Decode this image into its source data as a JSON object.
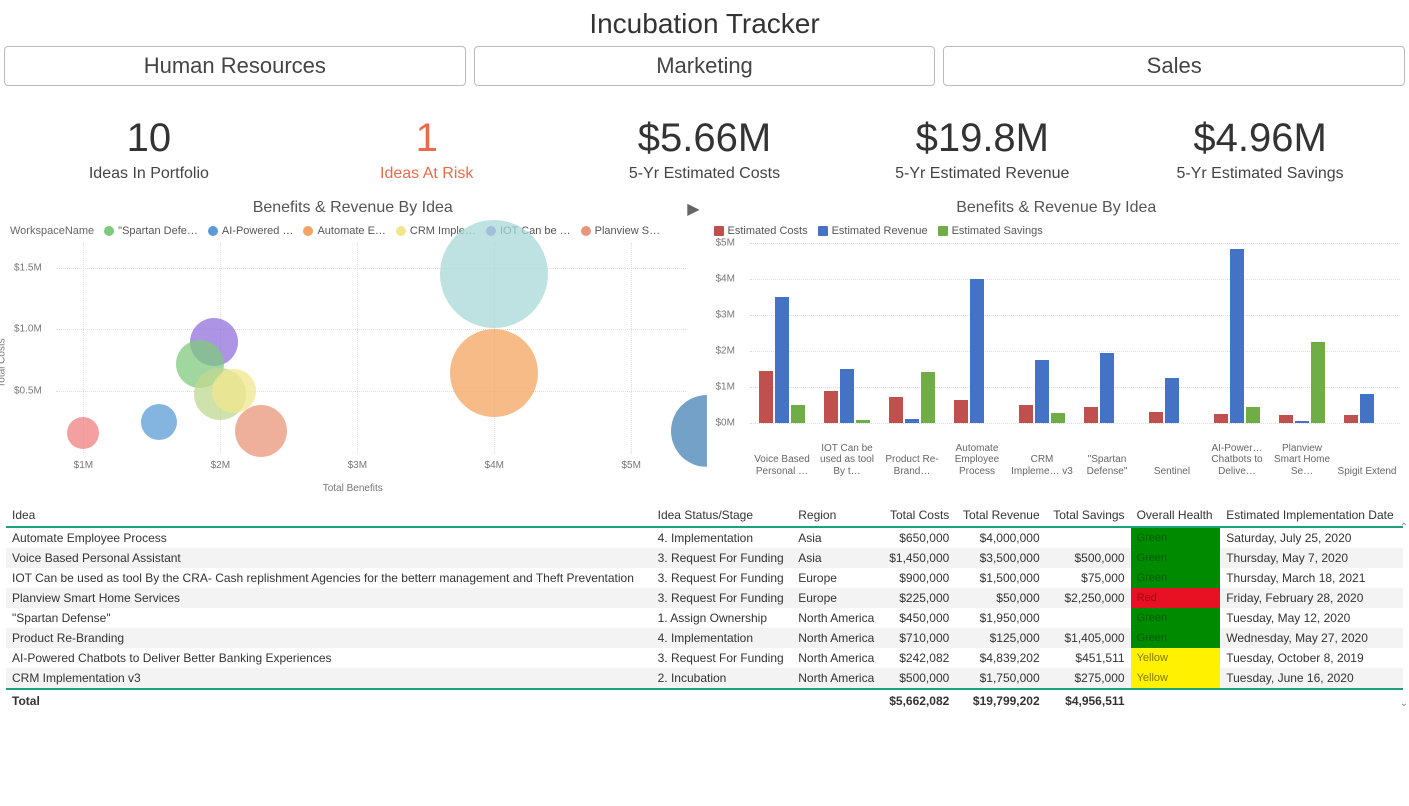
{
  "page": {
    "title": "Incubation Tracker"
  },
  "tabs": [
    "Human Resources",
    "Marketing",
    "Sales"
  ],
  "kpis": [
    {
      "value": "10",
      "label": "Ideas In Portfolio",
      "risk": false
    },
    {
      "value": "1",
      "label": "Ideas At Risk",
      "risk": true
    },
    {
      "value": "$5.66M",
      "label": "5-Yr Estimated Costs",
      "risk": false
    },
    {
      "value": "$19.8M",
      "label": "5-Yr Estimated Revenue",
      "risk": false
    },
    {
      "value": "$4.96M",
      "label": "5-Yr Estimated Savings",
      "risk": false
    }
  ],
  "colors": {
    "series": {
      "costs": "#c0504d",
      "revenue": "#4472c4",
      "savings": "#70ad47"
    },
    "bubble": {
      "spartan": "#7fc97f",
      "ai": "#5b9bd5",
      "automate": "#f4a460",
      "crm": "#f0e68c",
      "iot": "#9370db",
      "planview": "#e9967a",
      "voice": "#a8d8d8",
      "product": "#c0d890",
      "sentinel": "#f08080",
      "spigit": "#4682b4"
    }
  },
  "chart_data": [
    {
      "id": "bubbles",
      "type": "scatter",
      "title": "Benefits & Revenue By Idea",
      "xlabel": "Total Benefits",
      "ylabel": "Total Costs",
      "legend_prefix": "WorkspaceName",
      "legend": [
        {
          "label": "\"Spartan Defe…",
          "colorKey": "spartan"
        },
        {
          "label": "AI-Powered …",
          "colorKey": "ai"
        },
        {
          "label": "Automate E…",
          "colorKey": "automate"
        },
        {
          "label": "CRM Imple…",
          "colorKey": "crm"
        },
        {
          "label": "IOT Can be …",
          "colorKey": "iot"
        },
        {
          "label": "Planview S…",
          "colorKey": "planview"
        }
      ],
      "xlim": [
        800000,
        5400000
      ],
      "ylim": [
        0,
        1700000
      ],
      "xticks": [
        {
          "v": 1000000,
          "t": "$1M"
        },
        {
          "v": 2000000,
          "t": "$2M"
        },
        {
          "v": 3000000,
          "t": "$3M"
        },
        {
          "v": 4000000,
          "t": "$4M"
        },
        {
          "v": 5000000,
          "t": "$5M"
        }
      ],
      "yticks": [
        {
          "v": 500000,
          "t": "$0.5M"
        },
        {
          "v": 1000000,
          "t": "$1.0M"
        },
        {
          "v": 1500000,
          "t": "$1.5M"
        }
      ],
      "points": [
        {
          "x": 4000000,
          "y": 1450000,
          "r": 54,
          "colorKey": "voice"
        },
        {
          "x": 4000000,
          "y": 650000,
          "r": 44,
          "colorKey": "automate"
        },
        {
          "x": 1950000,
          "y": 900000,
          "r": 24,
          "colorKey": "iot"
        },
        {
          "x": 1850000,
          "y": 720000,
          "r": 24,
          "colorKey": "spartan"
        },
        {
          "x": 2000000,
          "y": 480000,
          "r": 26,
          "colorKey": "product"
        },
        {
          "x": 2100000,
          "y": 500000,
          "r": 22,
          "colorKey": "crm"
        },
        {
          "x": 1550000,
          "y": 250000,
          "r": 18,
          "colorKey": "ai"
        },
        {
          "x": 2300000,
          "y": 180000,
          "r": 26,
          "colorKey": "planview"
        },
        {
          "x": 1000000,
          "y": 160000,
          "r": 16,
          "colorKey": "sentinel"
        },
        {
          "x": 5290000,
          "y": 180000,
          "r": 36,
          "colorKey": "spigit",
          "half": true
        }
      ]
    },
    {
      "id": "bars",
      "type": "bar",
      "title": "Benefits & Revenue By Idea",
      "ylabel": "",
      "xlabel": "",
      "legend": [
        {
          "label": "Estimated Costs",
          "colorKey": "costs"
        },
        {
          "label": "Estimated Revenue",
          "colorKey": "revenue"
        },
        {
          "label": "Estimated Savings",
          "colorKey": "savings"
        }
      ],
      "ylim": [
        0,
        5000000
      ],
      "yticks": [
        {
          "v": 0,
          "t": "$0M"
        },
        {
          "v": 1000000,
          "t": "$1M"
        },
        {
          "v": 2000000,
          "t": "$2M"
        },
        {
          "v": 3000000,
          "t": "$3M"
        },
        {
          "v": 4000000,
          "t": "$4M"
        },
        {
          "v": 5000000,
          "t": "$5M"
        }
      ],
      "categories": [
        "Voice Based Personal …",
        "IOT Can be used as tool By t…",
        "Product Re-Brand…",
        "Automate Employee Process",
        "CRM Impleme… v3",
        "\"Spartan Defense\"",
        "Sentinel",
        "AI-Power… Chatbots to Delive…",
        "Planview Smart Home Se…",
        "Spigit Extend"
      ],
      "series": [
        {
          "name": "Estimated Costs",
          "colorKey": "costs",
          "values": [
            1450000,
            900000,
            710000,
            650000,
            500000,
            450000,
            300000,
            242082,
            225000,
            235000
          ]
        },
        {
          "name": "Estimated Revenue",
          "colorKey": "revenue",
          "values": [
            3500000,
            1500000,
            125000,
            4000000,
            1750000,
            1950000,
            1250000,
            4839202,
            50000,
            800000
          ]
        },
        {
          "name": "Estimated Savings",
          "colorKey": "savings",
          "values": [
            500000,
            75000,
            1405000,
            0,
            275000,
            0,
            0,
            451511,
            2250000,
            0
          ]
        }
      ]
    }
  ],
  "table": {
    "headers": [
      "Idea",
      "Idea Status/Stage",
      "Region",
      "Total Costs",
      "Total Revenue",
      "Total Savings",
      "Overall Health",
      "Estimated Implementation Date"
    ],
    "totalLabel": "Total",
    "rows": [
      {
        "idea": "Automate Employee Process",
        "stage": "4. Implementation",
        "region": "Asia",
        "costs": "$650,000",
        "revenue": "$4,000,000",
        "savings": "",
        "health": "Green",
        "date": "Saturday, July 25, 2020"
      },
      {
        "idea": "Voice Based Personal Assistant",
        "stage": "3. Request For Funding",
        "region": "Asia",
        "costs": "$1,450,000",
        "revenue": "$3,500,000",
        "savings": "$500,000",
        "health": "Green",
        "date": "Thursday, May 7, 2020"
      },
      {
        "idea": "IOT Can be used as tool By the CRA- Cash replishment Agencies for the betterr management and Theft Preventation",
        "stage": "3. Request For Funding",
        "region": "Europe",
        "costs": "$900,000",
        "revenue": "$1,500,000",
        "savings": "$75,000",
        "health": "Green",
        "date": "Thursday, March 18, 2021"
      },
      {
        "idea": "Planview Smart Home Services",
        "stage": "3. Request For Funding",
        "region": "Europe",
        "costs": "$225,000",
        "revenue": "$50,000",
        "savings": "$2,250,000",
        "health": "Red",
        "date": "Friday, February 28, 2020"
      },
      {
        "idea": "\"Spartan Defense\"",
        "stage": "1. Assign Ownership",
        "region": "North America",
        "costs": "$450,000",
        "revenue": "$1,950,000",
        "savings": "",
        "health": "Green",
        "date": "Tuesday, May 12, 2020"
      },
      {
        "idea": "Product Re-Branding",
        "stage": "4. Implementation",
        "region": "North America",
        "costs": "$710,000",
        "revenue": "$125,000",
        "savings": "$1,405,000",
        "health": "Green",
        "date": "Wednesday, May 27, 2020"
      },
      {
        "idea": "AI-Powered Chatbots to Deliver Better Banking Experiences",
        "stage": "3. Request For Funding",
        "region": "North America",
        "costs": "$242,082",
        "revenue": "$4,839,202",
        "savings": "$451,511",
        "health": "Yellow",
        "date": "Tuesday, October 8, 2019"
      },
      {
        "idea": "CRM Implementation v3",
        "stage": "2. Incubation",
        "region": "North America",
        "costs": "$500,000",
        "revenue": "$1,750,000",
        "savings": "$275,000",
        "health": "Yellow",
        "date": "Tuesday, June 16, 2020"
      }
    ],
    "totals": {
      "costs": "$5,662,082",
      "revenue": "$19,799,202",
      "savings": "$4,956,511"
    }
  }
}
